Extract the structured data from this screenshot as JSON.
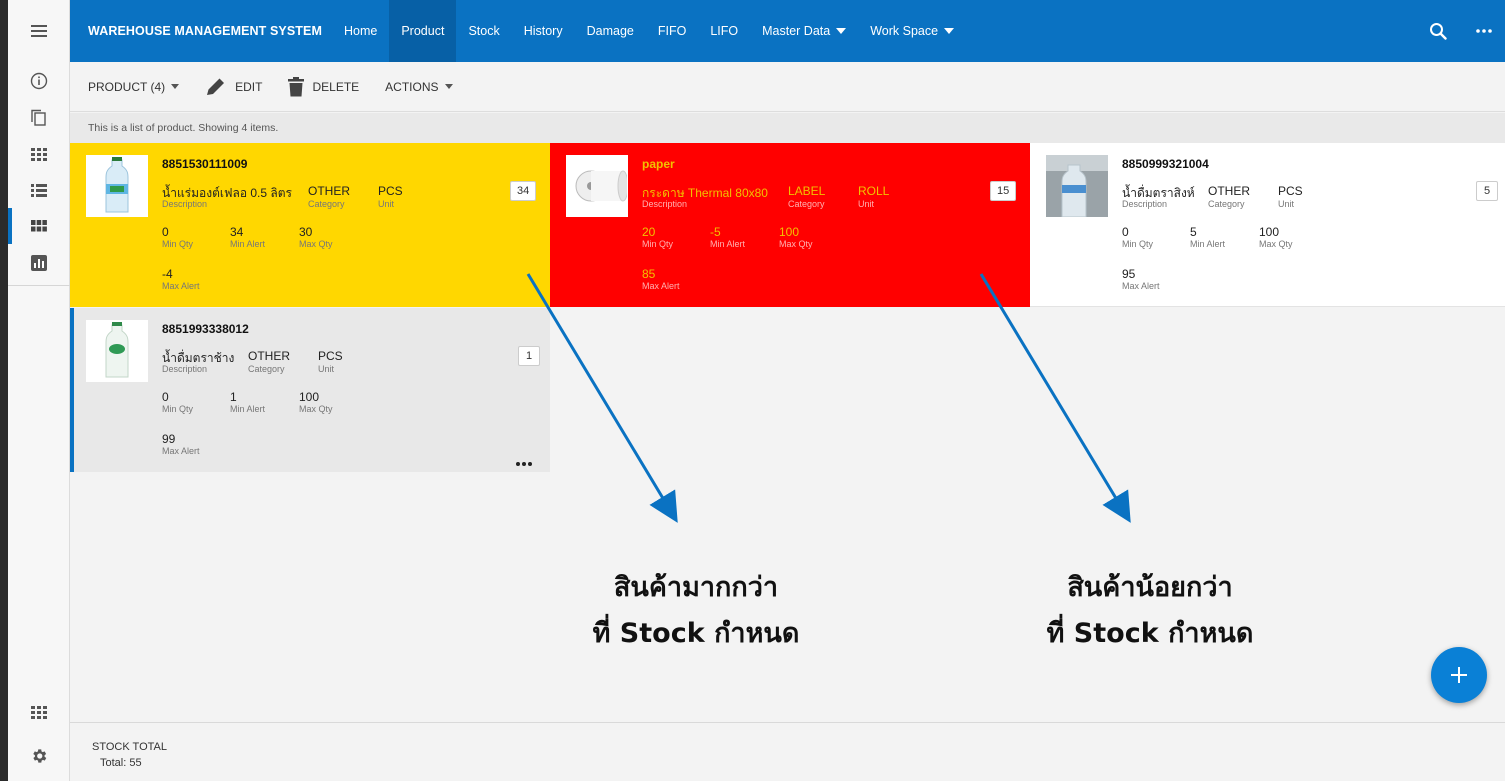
{
  "app": {
    "title": "WAREHOUSE MANAGEMENT SYSTEM",
    "nav": [
      "Home",
      "Product",
      "Stock",
      "History",
      "Damage",
      "FIFO",
      "LIFO",
      "Master Data",
      "Work Space"
    ],
    "active_nav": "Product",
    "accent": "#0a72c2"
  },
  "toolbar": {
    "product_label": "PRODUCT (4)",
    "edit_label": "EDIT",
    "delete_label": "DELETE",
    "actions_label": "ACTIONS"
  },
  "info": "This is a list of product. Showing 4 items.",
  "labels": {
    "description": "Description",
    "category": "Category",
    "unit": "Unit",
    "min_qty": "Min Qty",
    "min_alert": "Min Alert",
    "max_qty": "Max Qty",
    "max_alert": "Max Alert"
  },
  "products": [
    {
      "code": "8851530111009",
      "description": "น้ำแร่มองต์เฟลอ 0.5 ลิตร",
      "category": "OTHER",
      "unit": "PCS",
      "stock": "34",
      "min_qty": "0",
      "min_alert": "34",
      "max_qty": "30",
      "max_alert": "-4",
      "color": "#ffd700"
    },
    {
      "code": "paper",
      "description": "กระดาษ Thermal 80x80",
      "category": "LABEL",
      "unit": "ROLL",
      "stock": "15",
      "min_qty": "20",
      "min_alert": "-5",
      "max_qty": "100",
      "max_alert": "85",
      "color": "#ff0000"
    },
    {
      "code": "8850999321004",
      "description": "น้ำดื่มตราสิงห์",
      "category": "OTHER",
      "unit": "PCS",
      "stock": "5",
      "min_qty": "0",
      "min_alert": "5",
      "max_qty": "100",
      "max_alert": "95",
      "color": "#ffffff"
    },
    {
      "code": "8851993338012",
      "description": "น้ำดื่มตราช้าง",
      "category": "OTHER",
      "unit": "PCS",
      "stock": "1",
      "min_qty": "0",
      "min_alert": "1",
      "max_qty": "100",
      "max_alert": "99",
      "color": "#e8e8e8"
    }
  ],
  "annotations": {
    "left_line1": "สินค้ามากกว่า",
    "left_line2": "ที่ Stock กำหนด",
    "right_line1": "สินค้าน้อยกว่า",
    "right_line2": "ที่ Stock กำหนด",
    "arrow_color": "#0a72c2"
  },
  "footer": {
    "title": "STOCK TOTAL",
    "total": "Total: 55"
  },
  "icons": [
    "menu-icon",
    "info-icon",
    "copy-icon",
    "grid-icon",
    "list-icon",
    "tile-icon",
    "chart-icon",
    "apps-icon",
    "gear-icon",
    "search-icon",
    "more-icon",
    "pencil-icon",
    "trash-icon",
    "plus-icon",
    "more-horizontal-icon"
  ]
}
